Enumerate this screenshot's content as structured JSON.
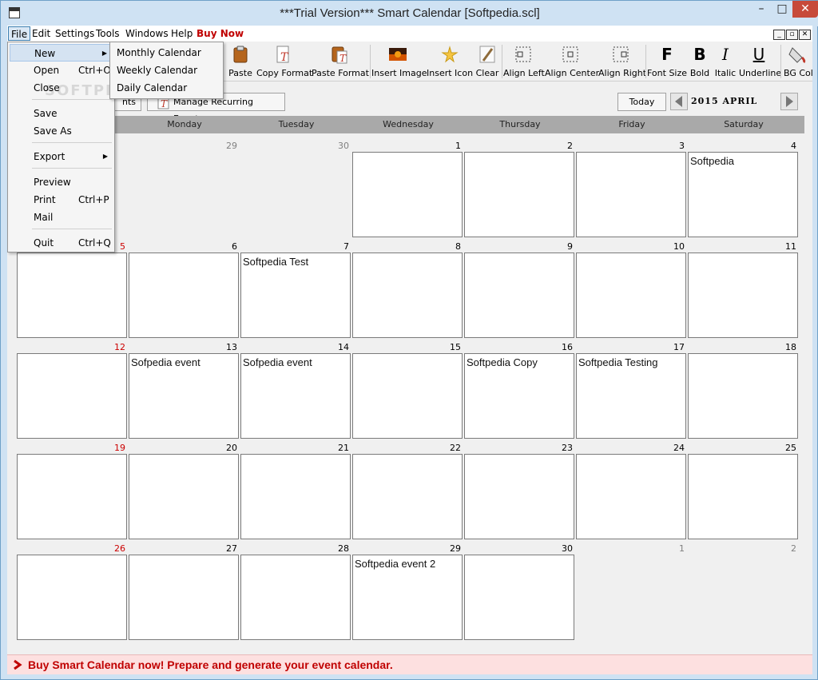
{
  "window": {
    "title": "***Trial Version*** Smart Calendar [Softpedia.scl]",
    "minimize": "–",
    "maximize": "□",
    "close": "✕"
  },
  "menubar": {
    "items": [
      "File",
      "Edit",
      "Settings",
      "Tools",
      "Windows",
      "Help"
    ],
    "buy_now": "Buy Now",
    "mdi_buttons": [
      "_",
      "▫",
      "✕"
    ]
  },
  "toolbar": {
    "buttons": [
      {
        "label": "Paste",
        "icon": "paste-icon"
      },
      {
        "label": "Copy Format",
        "icon": "copy-format-icon"
      },
      {
        "label": "Paste Format",
        "icon": "paste-format-icon"
      },
      {
        "label": "Insert Image",
        "icon": "insert-image-icon"
      },
      {
        "label": "Insert Icon",
        "icon": "insert-icon-icon"
      },
      {
        "label": "Clear",
        "icon": "clear-brush-icon"
      },
      {
        "label": "Align Left",
        "icon": "align-left-icon"
      },
      {
        "label": "Align Center",
        "icon": "align-center-icon"
      },
      {
        "label": "Align Right",
        "icon": "align-right-icon"
      },
      {
        "label": "Font Size",
        "icon": "font-size-icon"
      },
      {
        "label": "Bold",
        "icon": "bold-icon"
      },
      {
        "label": "Italic",
        "icon": "italic-icon"
      },
      {
        "label": "Underline",
        "icon": "underline-icon"
      },
      {
        "label": "BG Colo",
        "icon": "bg-color-icon"
      }
    ],
    "glyphs": {
      "font_size": "F",
      "bold": "B",
      "italic": "I",
      "underline": "U"
    }
  },
  "nav": {
    "events_partial": "nts",
    "manage_recurring": "Manage Recurring Events",
    "today": "Today",
    "month_label": "2015 APRIL"
  },
  "calendar": {
    "weekdays": [
      "",
      "Monday",
      "Tuesday",
      "Wednesday",
      "Thursday",
      "Friday",
      "Saturday"
    ],
    "weeks": [
      [
        {
          "day": "",
          "muted": true,
          "sunday": false,
          "box": false,
          "event": ""
        },
        {
          "day": "29",
          "muted": true,
          "sunday": false,
          "box": false,
          "event": ""
        },
        {
          "day": "30",
          "muted": true,
          "sunday": false,
          "box": false,
          "event": ""
        },
        {
          "day": "1",
          "muted": false,
          "sunday": false,
          "box": true,
          "event": ""
        },
        {
          "day": "2",
          "muted": false,
          "sunday": false,
          "box": true,
          "event": ""
        },
        {
          "day": "3",
          "muted": false,
          "sunday": false,
          "box": true,
          "event": ""
        },
        {
          "day": "4",
          "muted": false,
          "sunday": false,
          "box": true,
          "event": "Softpedia"
        }
      ],
      [
        {
          "day": "5",
          "muted": false,
          "sunday": true,
          "box": true,
          "event": ""
        },
        {
          "day": "6",
          "muted": false,
          "sunday": false,
          "box": true,
          "event": ""
        },
        {
          "day": "7",
          "muted": false,
          "sunday": false,
          "box": true,
          "event": "Softpedia Test"
        },
        {
          "day": "8",
          "muted": false,
          "sunday": false,
          "box": true,
          "event": ""
        },
        {
          "day": "9",
          "muted": false,
          "sunday": false,
          "box": true,
          "event": ""
        },
        {
          "day": "10",
          "muted": false,
          "sunday": false,
          "box": true,
          "event": ""
        },
        {
          "day": "11",
          "muted": false,
          "sunday": false,
          "box": true,
          "event": ""
        }
      ],
      [
        {
          "day": "12",
          "muted": false,
          "sunday": true,
          "box": true,
          "event": ""
        },
        {
          "day": "13",
          "muted": false,
          "sunday": false,
          "box": true,
          "event": "Sofpedia event"
        },
        {
          "day": "14",
          "muted": false,
          "sunday": false,
          "box": true,
          "event": "Sofpedia event"
        },
        {
          "day": "15",
          "muted": false,
          "sunday": false,
          "box": true,
          "event": ""
        },
        {
          "day": "16",
          "muted": false,
          "sunday": false,
          "box": true,
          "event": "Softpedia Copy"
        },
        {
          "day": "17",
          "muted": false,
          "sunday": false,
          "box": true,
          "event": "Softpedia Testing"
        },
        {
          "day": "18",
          "muted": false,
          "sunday": false,
          "box": true,
          "event": ""
        }
      ],
      [
        {
          "day": "19",
          "muted": false,
          "sunday": true,
          "box": true,
          "event": ""
        },
        {
          "day": "20",
          "muted": false,
          "sunday": false,
          "box": true,
          "event": ""
        },
        {
          "day": "21",
          "muted": false,
          "sunday": false,
          "box": true,
          "event": ""
        },
        {
          "day": "22",
          "muted": false,
          "sunday": false,
          "box": true,
          "event": ""
        },
        {
          "day": "23",
          "muted": false,
          "sunday": false,
          "box": true,
          "event": ""
        },
        {
          "day": "24",
          "muted": false,
          "sunday": false,
          "box": true,
          "event": ""
        },
        {
          "day": "25",
          "muted": false,
          "sunday": false,
          "box": true,
          "event": ""
        }
      ],
      [
        {
          "day": "26",
          "muted": false,
          "sunday": true,
          "box": true,
          "event": ""
        },
        {
          "day": "27",
          "muted": false,
          "sunday": false,
          "box": true,
          "event": ""
        },
        {
          "day": "28",
          "muted": false,
          "sunday": false,
          "box": true,
          "event": ""
        },
        {
          "day": "29",
          "muted": false,
          "sunday": false,
          "box": true,
          "event": "Softpedia event 2"
        },
        {
          "day": "30",
          "muted": false,
          "sunday": false,
          "box": true,
          "event": ""
        },
        {
          "day": "1",
          "muted": true,
          "sunday": false,
          "box": false,
          "event": ""
        },
        {
          "day": "2",
          "muted": true,
          "sunday": false,
          "box": false,
          "event": ""
        }
      ]
    ]
  },
  "file_menu": {
    "items": [
      {
        "label": "New",
        "shortcut": "",
        "submenu": true,
        "highlighted": true
      },
      {
        "label": "Open",
        "shortcut": "Ctrl+O",
        "submenu": false,
        "highlighted": false
      },
      {
        "label": "Close",
        "shortcut": "",
        "submenu": false,
        "highlighted": false
      },
      {
        "label": "Save",
        "shortcut": "",
        "submenu": false,
        "highlighted": false
      },
      {
        "label": "Save As",
        "shortcut": "",
        "submenu": false,
        "highlighted": false
      },
      {
        "label": "Export",
        "shortcut": "",
        "submenu": true,
        "highlighted": false
      },
      {
        "label": "Preview",
        "shortcut": "",
        "submenu": false,
        "highlighted": false
      },
      {
        "label": "Print",
        "shortcut": "Ctrl+P",
        "submenu": false,
        "highlighted": false
      },
      {
        "label": "Mail",
        "shortcut": "",
        "submenu": false,
        "highlighted": false
      },
      {
        "label": "Quit",
        "shortcut": "Ctrl+Q",
        "submenu": false,
        "highlighted": false
      }
    ]
  },
  "new_submenu": {
    "items": [
      "Monthly Calendar",
      "Weekly Calendar",
      "Daily Calendar"
    ]
  },
  "watermark": "SOFTPEDIA",
  "status": {
    "message": "Buy Smart Calendar now! Prepare and generate your event calendar."
  },
  "colors": {
    "accent_red": "#c00000",
    "sunday_red": "#cc0000",
    "header_gray": "#a9a9a9",
    "status_bg": "#fde0e0"
  }
}
